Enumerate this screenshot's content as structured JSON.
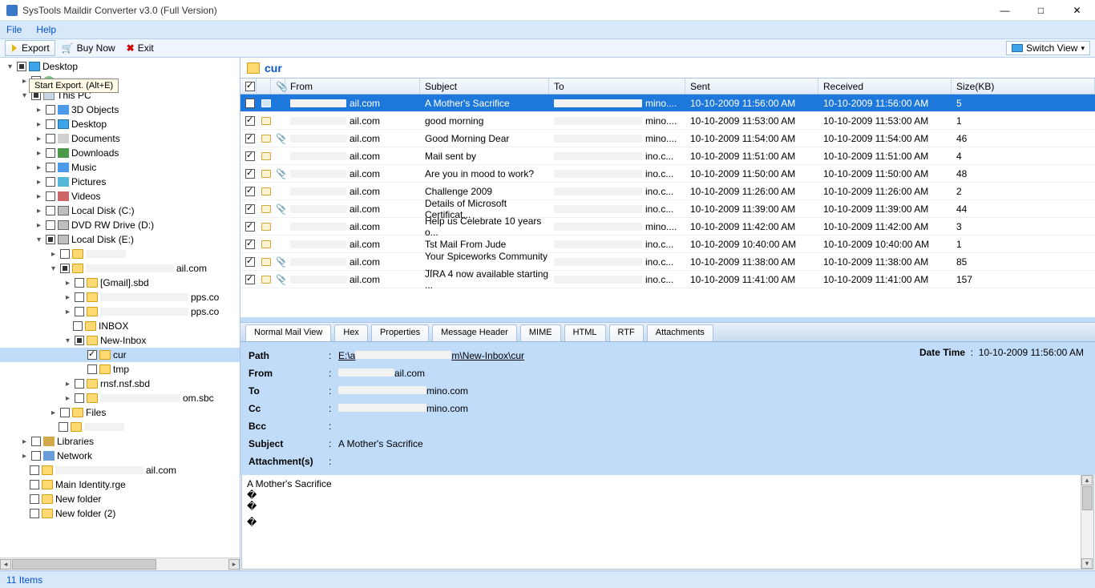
{
  "titlebar": {
    "title": "SysTools Maildir Converter v3.0 (Full Version)"
  },
  "menu": {
    "file": "File",
    "help": "Help"
  },
  "toolbar": {
    "export": "Export",
    "buy": "Buy Now",
    "exit": "Exit",
    "switch": "Switch View"
  },
  "tooltip": "Start Export. (Alt+E)",
  "tree": {
    "desktop": "Desktop",
    "thispc": "This PC",
    "obj3d": "3D Objects",
    "desk2": "Desktop",
    "docs": "Documents",
    "dl": "Downloads",
    "music": "Music",
    "pics": "Pictures",
    "vids": "Videos",
    "lc": "Local Disk (C:)",
    "dvd": "DVD RW Drive (D:)",
    "le": "Local Disk (E:)",
    "gmail": "[Gmail].sbd",
    "inbox": "INBOX",
    "newinbox": "New-Inbox",
    "cur": "cur",
    "tmp": "tmp",
    "rnsf": "rnsf.nsf.sbd",
    "files": "Files",
    "libs": "Libraries",
    "net": "Network",
    "ailcom": "ail.com",
    "mainid": "Main Identity.rge",
    "nf": "New folder",
    "nf2": "New folder (2)",
    "suffix_ail": "ail.com",
    "suffix_pps": "pps.co",
    "suffix_comsbd": "om.sbc"
  },
  "folder_header": "cur",
  "grid_headers": {
    "from": "From",
    "subject": "Subject",
    "to": "To",
    "sent": "Sent",
    "received": "Received",
    "size": "Size(KB)"
  },
  "rows": [
    {
      "from": "ail.com",
      "subject": "A Mother's Sacrifice",
      "to": "mino....",
      "sent": "10-10-2009 11:56:00 AM",
      "recv": "10-10-2009 11:56:00 AM",
      "size": "5",
      "sel": true,
      "att": false
    },
    {
      "from": "ail.com",
      "subject": "good morning",
      "to": "mino....",
      "sent": "10-10-2009 11:53:00 AM",
      "recv": "10-10-2009 11:53:00 AM",
      "size": "1",
      "att": false
    },
    {
      "from": "ail.com",
      "subject": "Good Morning Dear",
      "to": "mino....",
      "sent": "10-10-2009 11:54:00 AM",
      "recv": "10-10-2009 11:54:00 AM",
      "size": "46",
      "att": true
    },
    {
      "from": "ail.com",
      "subject": "Mail sent by",
      "to": "ino.c...",
      "sent": "10-10-2009 11:51:00 AM",
      "recv": "10-10-2009 11:51:00 AM",
      "size": "4",
      "att": false
    },
    {
      "from": "ail.com",
      "subject": "Are you in mood to work?",
      "to": "ino.c...",
      "sent": "10-10-2009 11:50:00 AM",
      "recv": "10-10-2009 11:50:00 AM",
      "size": "48",
      "att": true
    },
    {
      "from": "ail.com",
      "subject": "Challenge 2009",
      "to": "ino.c...",
      "sent": "10-10-2009 11:26:00 AM",
      "recv": "10-10-2009 11:26:00 AM",
      "size": "2",
      "att": false
    },
    {
      "from": "ail.com",
      "subject": "Details of Microsoft Certificat...",
      "to": "ino.c...",
      "sent": "10-10-2009 11:39:00 AM",
      "recv": "10-10-2009 11:39:00 AM",
      "size": "44",
      "att": true
    },
    {
      "from": "ail.com",
      "subject": "Help us Celebrate 10 years o...",
      "to": "mino....",
      "sent": "10-10-2009 11:42:00 AM",
      "recv": "10-10-2009 11:42:00 AM",
      "size": "3",
      "att": false
    },
    {
      "from": "ail.com",
      "subject": "Tst Mail From Jude",
      "to": "ino.c...",
      "sent": "10-10-2009 10:40:00 AM",
      "recv": "10-10-2009 10:40:00 AM",
      "size": "1",
      "att": false
    },
    {
      "from": "ail.com",
      "subject": "Your Spiceworks Community ...",
      "to": "ino.c...",
      "sent": "10-10-2009 11:38:00 AM",
      "recv": "10-10-2009 11:38:00 AM",
      "size": "85",
      "att": true
    },
    {
      "from": "ail.com",
      "subject": "JIRA 4 now available starting ...",
      "to": "ino.c...",
      "sent": "10-10-2009 11:41:00 AM",
      "recv": "10-10-2009 11:41:00 AM",
      "size": "157",
      "att": true
    }
  ],
  "tabs": {
    "normal": "Normal Mail View",
    "hex": "Hex",
    "prop": "Properties",
    "mh": "Message Header",
    "mime": "MIME",
    "html": "HTML",
    "rtf": "RTF",
    "att": "Attachments"
  },
  "meta": {
    "path_label": "Path",
    "path_pre": "E:\\a",
    "path_post": "m\\New-Inbox\\cur",
    "from_label": "From",
    "from_suffix": "ail.com",
    "to_label": "To",
    "to_suffix": "mino.com",
    "cc_label": "Cc",
    "cc_suffix": "mino.com",
    "bcc_label": "Bcc",
    "subject_label": "Subject",
    "subject": "A Mother's Sacrifice",
    "att_label": "Attachment(s)",
    "dt_label": "Date Time",
    "dt": "10-10-2009 11:56:00 AM"
  },
  "body": {
    "l1": "A Mother's Sacrifice",
    "glyph": "�"
  },
  "status": "11 Items"
}
